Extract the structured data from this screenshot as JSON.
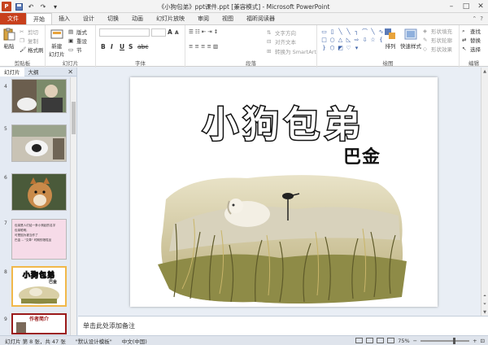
{
  "window": {
    "title": "《小狗包弟》ppt课件.ppt [兼容模式] - Microsoft PowerPoint",
    "app_letter": "P"
  },
  "ribbon_tabs": [
    "文件",
    "开始",
    "插入",
    "设计",
    "切换",
    "动画",
    "幻灯片放映",
    "审阅",
    "视图",
    "福昕阅读器"
  ],
  "ribbon": {
    "clipboard": {
      "label": "剪贴板",
      "paste": "粘贴",
      "cut": "剪切",
      "copy": "复制",
      "format_painter": "格式刷"
    },
    "slides": {
      "label": "幻灯片",
      "new_slide": "新建\n幻灯片",
      "layout": "版式",
      "reset": "重设",
      "section": "节"
    },
    "font": {
      "label": "字体",
      "bold": "B",
      "italic": "I",
      "underline": "U",
      "shadow": "S",
      "strike": "abc",
      "grow": "A",
      "shrink": "A"
    },
    "paragraph": {
      "label": "段落",
      "text_direction": "文字方向",
      "align_text": "对齐文本",
      "smartart": "转换为 SmartArt"
    },
    "drawing": {
      "label": "绘图",
      "arrange": "排列",
      "quick_styles": "快速样式",
      "shape_fill": "形状填充",
      "shape_outline": "形状轮廓",
      "shape_effects": "形状效果"
    },
    "editing": {
      "label": "编辑",
      "find": "查找",
      "replace": "替换",
      "select": "选择"
    }
  },
  "pane": {
    "tabs": [
      "幻灯片",
      "大纲"
    ],
    "thumbnails": [
      {
        "num": "4",
        "kind": "photo"
      },
      {
        "num": "5",
        "kind": "photo"
      },
      {
        "num": "6",
        "kind": "photo"
      },
      {
        "num": "7",
        "kind": "text",
        "lines": [
          "包弟是人们给一条小狗起的名字",
          "包弟聪明,",
          "可是因为被当作了",
          "巴金 -- \"文革\" 时期的牺牲品"
        ]
      },
      {
        "num": "8",
        "kind": "current",
        "title": "小狗包弟",
        "author": "巴金"
      },
      {
        "num": "9",
        "kind": "intro",
        "title": "作者简介"
      }
    ]
  },
  "slide": {
    "title": "小狗包弟",
    "author": "巴金"
  },
  "notes": {
    "placeholder": "单击此处添加备注"
  },
  "status": {
    "slide_info": "幻灯片 第 8 张，共 47 张",
    "theme": "\"默认设计模板\"",
    "language": "中文(中国)",
    "zoom": "75%"
  },
  "colors": {
    "file_tab": "#c8401c",
    "thumb_selected": "#f1b84a"
  }
}
